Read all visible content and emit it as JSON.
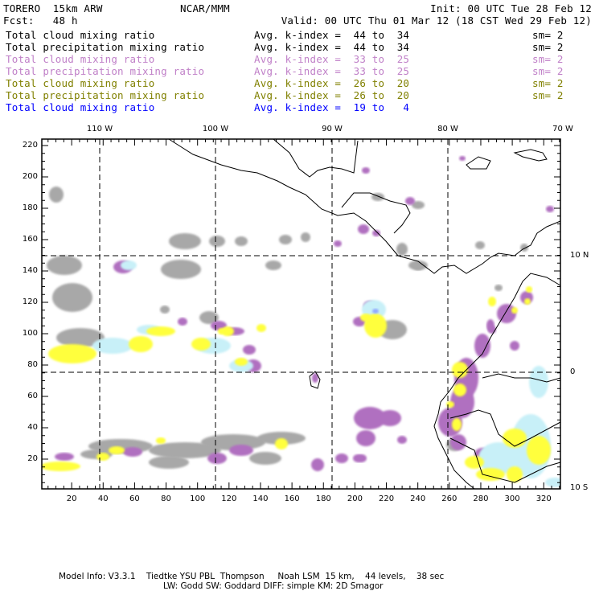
{
  "header": {
    "model": "TORERO  15km ARW",
    "org": "NCAR/MMM",
    "init": "Init: 00 UTC Tue 28 Feb 12",
    "fcst": "Fcst:   48 h",
    "valid": "Valid: 00 UTC Thu 01 Mar 12 (18 CST Wed 29 Feb 12)"
  },
  "legend": [
    {
      "field": "Total cloud mixing ratio",
      "range": "Avg. k-index =  44 to  34",
      "sm": "sm= 2",
      "color": "#000000"
    },
    {
      "field": "Total precipitation mixing ratio",
      "range": "Avg. k-index =  44 to  34",
      "sm": "sm= 2",
      "color": "#000000"
    },
    {
      "field": "Total cloud mixing ratio",
      "range": "Avg. k-index =  33 to  25",
      "sm": "sm= 2",
      "color": "#c080c8"
    },
    {
      "field": "Total precipitation mixing ratio",
      "range": "Avg. k-index =  33 to  25",
      "sm": "sm= 2",
      "color": "#c080c8"
    },
    {
      "field": "Total cloud mixing ratio",
      "range": "Avg. k-index =  26 to  20",
      "sm": "sm= 2",
      "color": "#808000"
    },
    {
      "field": "Total precipitation mixing ratio",
      "range": "Avg. k-index =  26 to  20",
      "sm": "sm= 2",
      "color": "#808000"
    },
    {
      "field": "Total cloud mixing ratio",
      "range": "Avg. k-index =  19 to   4",
      "sm": "",
      "color": "#0000ff"
    }
  ],
  "map": {
    "lon_labels": [
      "110 W",
      "100 W",
      "90 W",
      "80 W",
      "70 W"
    ],
    "lat_labels": [
      "10 N",
      "0",
      "10 S"
    ],
    "x_ticks": [
      "20",
      "40",
      "60",
      "80",
      "100",
      "120",
      "140",
      "160",
      "180",
      "200",
      "220",
      "240",
      "260",
      "280",
      "300",
      "320"
    ],
    "y_ticks": [
      "20",
      "40",
      "60",
      "80",
      "100",
      "120",
      "140",
      "160",
      "180",
      "200",
      "220"
    ],
    "colors": {
      "gray": "#a8a8a8",
      "purple": "#b070c0",
      "yellow": "#ffff3c",
      "cyan": "#c8f0f8",
      "blue": "#8fa8ff"
    }
  },
  "footer": {
    "line1": "Model Info: V3.3.1    Tiedtke YSU PBL  Thompson     Noah LSM  15 km,    44 levels,    38 sec",
    "line2": "LW: Godd SW: Goddard DIFF: simple KM: 2D Smagor"
  }
}
